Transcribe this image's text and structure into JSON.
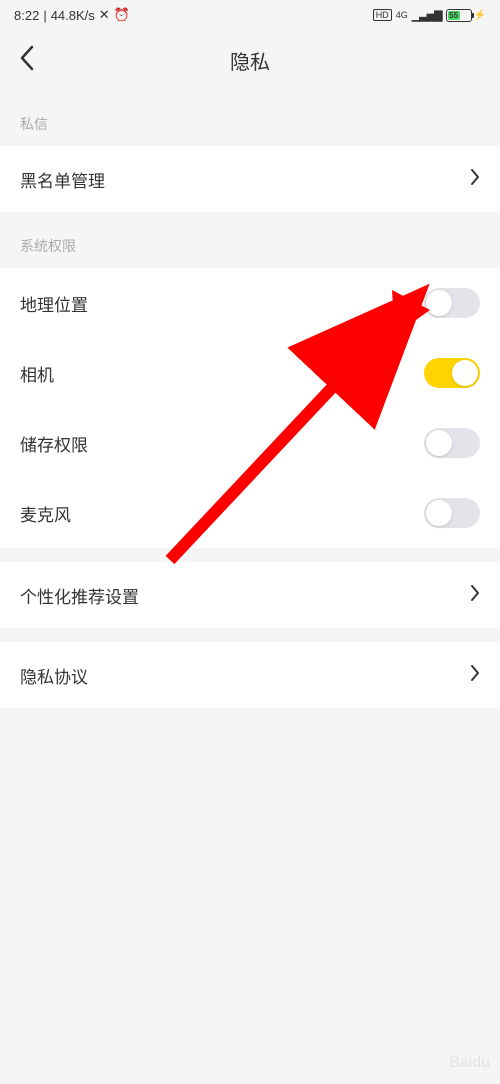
{
  "status_bar": {
    "time": "8:22",
    "net_speed": "44.8K/s",
    "hd_badge": "HD",
    "network": "4G",
    "battery_pct": "55"
  },
  "header": {
    "title": "隐私"
  },
  "sections": {
    "private_msg": {
      "header": "私信",
      "items": {
        "blacklist": "黑名单管理"
      }
    },
    "system_perms": {
      "header": "系统权限",
      "location": {
        "label": "地理位置",
        "enabled": false
      },
      "camera": {
        "label": "相机",
        "enabled": true
      },
      "storage": {
        "label": "储存权限",
        "enabled": false
      },
      "microphone": {
        "label": "麦克风",
        "enabled": false
      }
    },
    "personalization": {
      "label": "个性化推荐设置"
    },
    "privacy_policy": {
      "label": "隐私协议"
    }
  },
  "annotation": {
    "arrow_color": "#ff0000"
  },
  "watermark": "Baidu"
}
